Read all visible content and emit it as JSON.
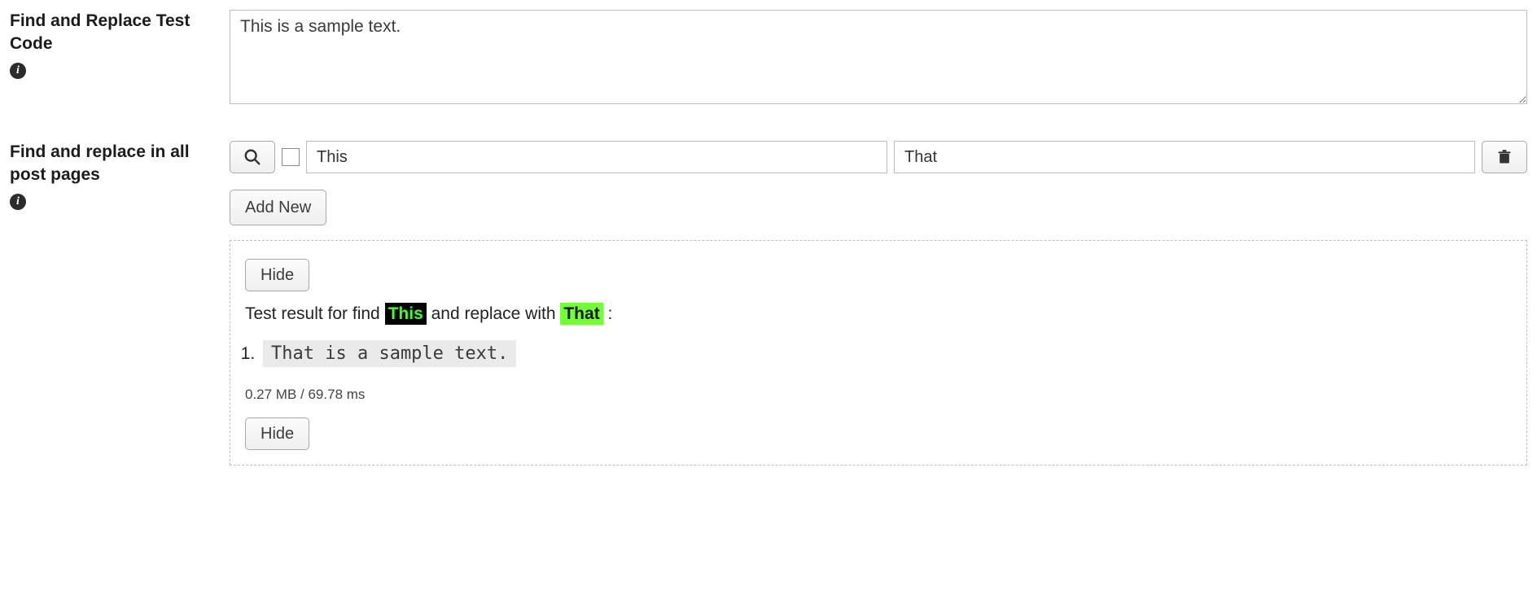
{
  "section1": {
    "label": "Find and Replace Test Code",
    "textarea_value": "This is a sample text."
  },
  "section2": {
    "label": "Find and replace in all post pages",
    "find_value": "This",
    "replace_value": "That",
    "add_new_label": "Add New"
  },
  "result": {
    "hide_label": "Hide",
    "sentence_prefix": "Test result for find ",
    "find_hl": "This",
    "sentence_mid": " and replace with ",
    "replace_hl": "That",
    "sentence_suffix": ":",
    "items": [
      "That is a sample text."
    ],
    "stats": "0.27 MB / 69.78 ms"
  }
}
